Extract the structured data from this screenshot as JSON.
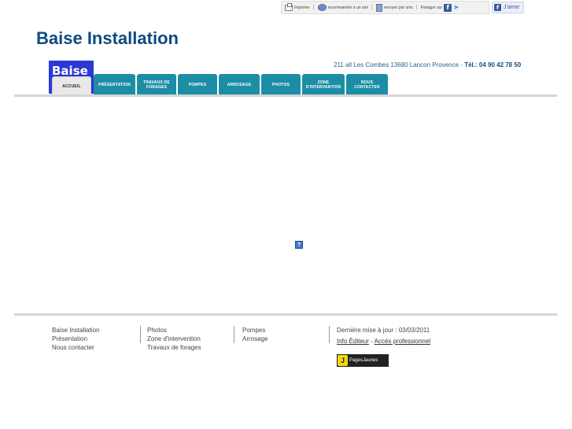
{
  "toolbar": {
    "print": "Imprimer",
    "recommend": "recommander à un ami",
    "send": "envoyer par sms",
    "share": "Partager sur",
    "like": "J'aime"
  },
  "header": {
    "title": "Baise Installation",
    "address": "211 all Les Combes 13680 Lancon Provence",
    "phone_label": "Tél.: 04 90 42 78 50",
    "logo_text": "Baise"
  },
  "nav": {
    "tabs": [
      {
        "label": "ACCUEIL",
        "active": true
      },
      {
        "label": "PRÉSENTATION",
        "active": false
      },
      {
        "label": "TRAVAUX DE FORAGES",
        "active": false
      },
      {
        "label": "POMPES",
        "active": false
      },
      {
        "label": "ARROSAGE",
        "active": false
      },
      {
        "label": "PHOTOS",
        "active": false
      },
      {
        "label": "ZONE D'INTERVENTION",
        "active": false
      },
      {
        "label": "NOUS CONTACTER",
        "active": false
      }
    ]
  },
  "main": {
    "placeholder_icon": "?"
  },
  "footer": {
    "col1": [
      "Baise Installation",
      "Présentation",
      "Nous contacter"
    ],
    "col2": [
      "Photos",
      "Zone d'intervention",
      "Travaux de forages"
    ],
    "col3": [
      "Pompes",
      "Arrosage"
    ],
    "last_update": "Dernière mise à jour : 03/03/2011",
    "info_editeur": "Info Éditeur",
    "separator": " - ",
    "acces_pro": "Accès professionnel",
    "pj_logo": "J",
    "pj_label": "PagesJaunes"
  },
  "colors": {
    "title": "#0d4a80",
    "tab": "#1b8ea5",
    "logo": "#2a38d4"
  }
}
